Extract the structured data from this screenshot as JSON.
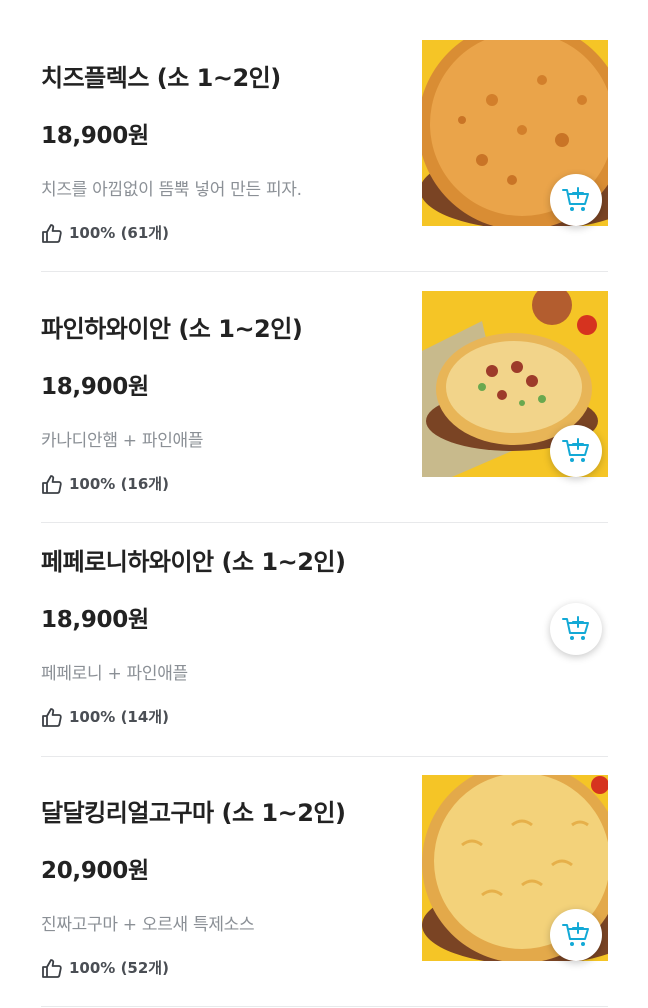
{
  "menu": [
    {
      "name": "치즈플렉스 (소 1~2인)",
      "price": "18,900원",
      "description": "치즈를 아낌없이 뜸뿍 넣어 만든 피자.",
      "rating": "100% (61개)",
      "has_image": true,
      "image": "cheese-pizza"
    },
    {
      "name": "파인하와이안 (소 1~2인)",
      "price": "18,900원",
      "description": "카나디안햄 + 파인애플",
      "rating": "100% (16개)",
      "has_image": true,
      "image": "hawaiian-pizza"
    },
    {
      "name": "페페로니하와이안 (소 1~2인)",
      "price": "18,900원",
      "description": "페페로니 + 파인애플",
      "rating": "100% (14개)",
      "has_image": false,
      "image": ""
    },
    {
      "name": "달달킹리얼고구마 (소 1~2인)",
      "price": "20,900원",
      "description": "진짜고구마 + 오르새 특제소스",
      "rating": "100% (52개)",
      "has_image": true,
      "image": "sweet-potato-pizza"
    }
  ],
  "icons": {
    "thumbs_up": "thumbs-up-icon",
    "add_to_cart": "cart-add-icon"
  },
  "colors": {
    "accent": "#13a9d6",
    "image_bg": "#f5c526",
    "description_text": "#8b9096",
    "divider": "#e8e9eb"
  }
}
